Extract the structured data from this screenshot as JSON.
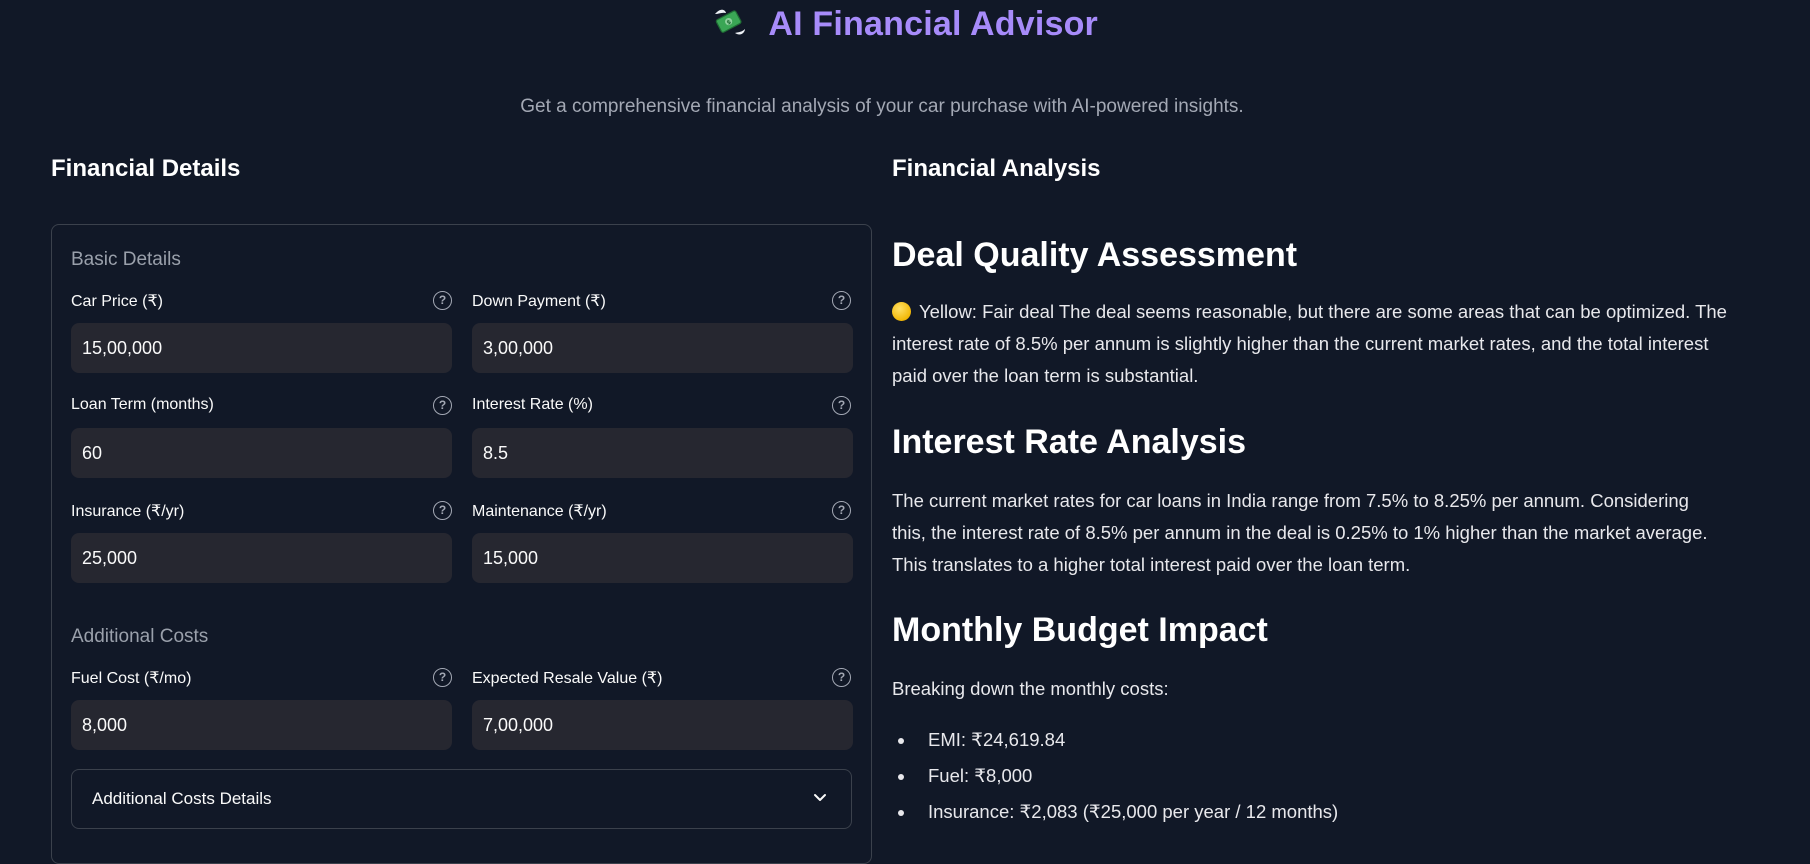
{
  "app": {
    "title": "AI Financial Advisor",
    "title_icon": "money-with-wings-icon",
    "subtitle": "Get a comprehensive financial analysis of your car purchase with AI-powered insights."
  },
  "left": {
    "heading": "Financial Details",
    "basic_section": "Basic Details",
    "fields": {
      "car_price": {
        "label": "Car Price (₹)",
        "value": "15,00,000"
      },
      "down_payment": {
        "label": "Down Payment (₹)",
        "value": "3,00,000"
      },
      "loan_term": {
        "label": "Loan Term (months)",
        "value": "60"
      },
      "interest_rate": {
        "label": "Interest Rate (%)",
        "value": "8.5"
      },
      "insurance": {
        "label": "Insurance (₹/yr)",
        "value": "25,000"
      },
      "maintenance": {
        "label": "Maintenance (₹/yr)",
        "value": "15,000"
      },
      "fuel_cost": {
        "label": "Fuel Cost (₹/mo)",
        "value": "8,000"
      },
      "resale_value": {
        "label": "Expected Resale Value (₹)",
        "value": "7,00,000"
      }
    },
    "additional_section": "Additional Costs",
    "expander_label": "Additional Costs Details"
  },
  "right": {
    "heading": "Financial Analysis",
    "deal_quality": {
      "title": "Deal Quality Assessment",
      "text": "Yellow: Fair deal The deal seems reasonable, but there are some areas that can be optimized. The interest rate of 8.5% per annum is slightly higher than the current market rates, and the total interest paid over the loan term is substantial.",
      "indicator_color": "#f2b807"
    },
    "interest_rate": {
      "title": "Interest Rate Analysis",
      "text": "The current market rates for car loans in India range from 7.5% to 8.25% per annum. Considering this, the interest rate of 8.5% per annum in the deal is 0.25% to 1% higher than the market average. This translates to a higher total interest paid over the loan term."
    },
    "budget": {
      "title": "Monthly Budget Impact",
      "intro": "Breaking down the monthly costs:",
      "items": [
        "EMI: ₹24,619.84",
        "Fuel: ₹8,000",
        "Insurance: ₹2,083 (₹25,000 per year / 12 months)"
      ]
    }
  },
  "colors": {
    "background": "#111827",
    "accent": "#a78bfa",
    "input_bg": "#262730"
  }
}
